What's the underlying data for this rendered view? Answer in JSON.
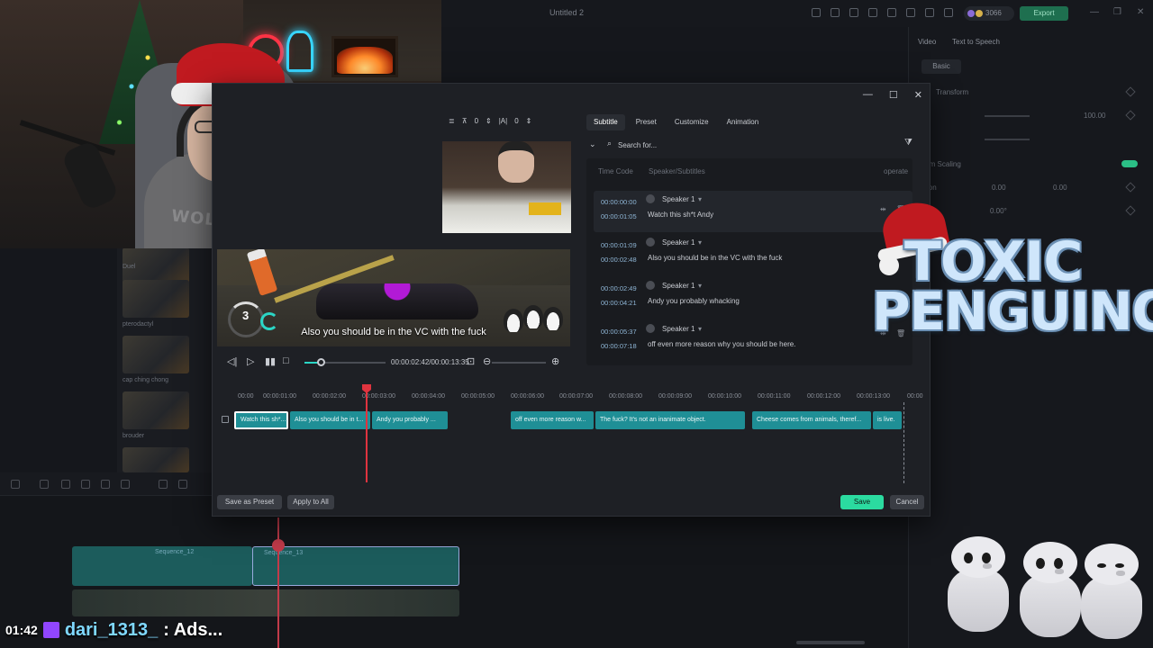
{
  "app": {
    "window_title": "Untitled 2",
    "export_label": "Export",
    "credits": "3066",
    "right_panel": {
      "tabs": [
        "Video",
        "Text to Speech"
      ],
      "basic_label": "Basic",
      "transform_label": "Transform",
      "scale_value": "100.00",
      "position_x": "0.00",
      "position_y": "0.00",
      "rotate_value": "0.00°",
      "scaling_label": "rm Scaling",
      "position_label": "ion"
    },
    "media_labels": [
      "Duel",
      "pterodactyl",
      "cap ching chong",
      "brouder"
    ]
  },
  "dialog": {
    "toolbar": {
      "value_a": "0",
      "value_b": "0"
    },
    "tabs": [
      {
        "label": "Subtitle",
        "active": true
      },
      {
        "label": "Preset",
        "active": false
      },
      {
        "label": "Customize",
        "active": false
      },
      {
        "label": "Animation",
        "active": false
      }
    ],
    "search": {
      "placeholder": "Search for..."
    },
    "list_headers": {
      "time_code": "Time Code",
      "speaker": "Speaker/Subtitles",
      "operate": "operate"
    },
    "subtitles": [
      {
        "start": "00:00:00:00",
        "end": "00:00:01:05",
        "speaker": "Speaker 1",
        "text": "Watch this sh*t Andy"
      },
      {
        "start": "00:00:01:09",
        "end": "00:00:02:48",
        "speaker": "Speaker 1",
        "text": "Also you should be in the VC with the fuck"
      },
      {
        "start": "00:00:02:49",
        "end": "00:00:04:21",
        "speaker": "Speaker 1",
        "text": "Andy you probably whacking"
      },
      {
        "start": "00:00:05:37",
        "end": "00:00:07:18",
        "speaker": "Speaker 1",
        "text": "off even more reason why you should be here."
      }
    ],
    "preview": {
      "subtitle": "Also you should be in the VC with the fuck",
      "speed_number": "3",
      "time_display": "00:00:02:42/00:00:13:35",
      "progress": 0.2
    },
    "timeline": {
      "ruler": [
        "00:00",
        "00:00:01:00",
        "00:00:02:00",
        "00:00:03:00",
        "00:00:04:00",
        "00:00:05:00",
        "00:00:06:00",
        "00:00:07:00",
        "00:00:08:00",
        "00:00:09:00",
        "00:00:10:00",
        "00:00:11:00",
        "00:00:12:00",
        "00:00:13:00",
        "00:00"
      ],
      "clips": [
        "Watch this sh*...",
        "Also you should be in t...",
        "Andy you probably ...",
        "off even more reason w...",
        "The fuck? It's not an inanimate object.",
        "Cheese comes from animals, theref...",
        "is live."
      ]
    },
    "buttons": {
      "save_as_preset": "Save as Preset",
      "apply_to_all": "Apply to All",
      "save": "Save",
      "cancel": "Cancel"
    }
  },
  "bottom_timeline": {
    "clip_labels": [
      "Sequence_12",
      "Sequence_13"
    ]
  },
  "chat": {
    "time": "01:42",
    "user": "dari_1313_",
    "message": ": Ads..."
  },
  "logo": {
    "line1": "TOXIC",
    "line2": "PENGUINO"
  }
}
